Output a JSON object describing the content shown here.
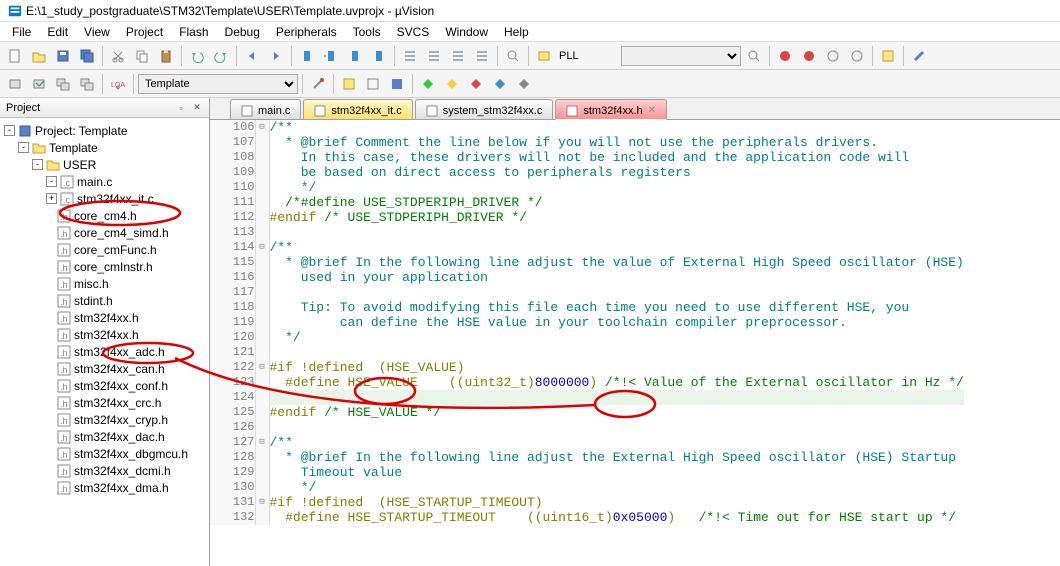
{
  "titlebar": "E:\\1_study_postgraduate\\STM32\\Template\\USER\\Template.uvprojx - µVision",
  "menu": [
    "File",
    "Edit",
    "View",
    "Project",
    "Flash",
    "Debug",
    "Peripherals",
    "Tools",
    "SVCS",
    "Window",
    "Help"
  ],
  "toolbar1": {
    "combo": ""
  },
  "toolbar2": {
    "target": "Template",
    "pll": "PLL"
  },
  "panel": {
    "title": "Project"
  },
  "tree": {
    "root": "Project: Template",
    "target": "Template",
    "group": "USER",
    "files": [
      "main.c",
      "stm32f4xx_it.c",
      "core_cm4.h",
      "core_cm4_simd.h",
      "core_cmFunc.h",
      "core_cmInstr.h",
      "misc.h",
      "stdint.h",
      "stm32f4xx.h",
      "stm32f4xx.h",
      "stm32f4xx_adc.h",
      "stm32f4xx_can.h",
      "stm32f4xx_conf.h",
      "stm32f4xx_crc.h",
      "stm32f4xx_cryp.h",
      "stm32f4xx_dac.h",
      "stm32f4xx_dbgmcu.h",
      "stm32f4xx_dcmi.h",
      "stm32f4xx_dma.h"
    ],
    "expanded": [
      true,
      false
    ]
  },
  "tabs": [
    {
      "label": "main.c",
      "state": "inactive"
    },
    {
      "label": "stm32f4xx_it.c",
      "state": "yellow"
    },
    {
      "label": "system_stm32f4xx.c",
      "state": "inactive"
    },
    {
      "label": "stm32f4xx.h",
      "state": "active"
    }
  ],
  "code_start": 106,
  "code_lines": [
    {
      "n": 106,
      "fold": "-",
      "cls": "",
      "html": "<span class='c-teal'>/**</span>"
    },
    {
      "n": 107,
      "fold": "",
      "cls": "",
      "html": "<span class='c-teal'>  * @brief Comment the line below if you will not use the peripherals drivers.</span>"
    },
    {
      "n": 108,
      "fold": "",
      "cls": "",
      "html": "<span class='c-teal'>    In this case, these drivers will not be included and the application code will</span>"
    },
    {
      "n": 109,
      "fold": "",
      "cls": "",
      "html": "<span class='c-teal'>    be based on direct access to peripherals registers</span>"
    },
    {
      "n": 110,
      "fold": "",
      "cls": "",
      "html": "<span class='c-teal'>    */</span>"
    },
    {
      "n": 111,
      "fold": "",
      "cls": "",
      "html": "  <span class='c-green'>/*#define USE_STDPERIPH_DRIVER */</span>"
    },
    {
      "n": 112,
      "fold": "",
      "cls": "",
      "html": "<span class='c-preproc'>#endif</span> <span class='c-green'>/* USE_STDPERIPH_DRIVER */</span>"
    },
    {
      "n": 113,
      "fold": "",
      "cls": "",
      "html": ""
    },
    {
      "n": 114,
      "fold": "-",
      "cls": "",
      "html": "<span class='c-teal'>/**</span>"
    },
    {
      "n": 115,
      "fold": "",
      "cls": "",
      "html": "<span class='c-teal'>  * @brief In the following line adjust the value of External High Speed oscillator (HSE)</span>"
    },
    {
      "n": 116,
      "fold": "",
      "cls": "",
      "html": "<span class='c-teal'>    used in your application</span>"
    },
    {
      "n": 117,
      "fold": "",
      "cls": "",
      "html": ""
    },
    {
      "n": 118,
      "fold": "",
      "cls": "",
      "html": "<span class='c-teal'>    Tip: To avoid modifying this file each time you need to use different HSE, you</span>"
    },
    {
      "n": 119,
      "fold": "",
      "cls": "",
      "html": "<span class='c-teal'>         can define the HSE value in your toolchain compiler preprocessor.</span>"
    },
    {
      "n": 120,
      "fold": "",
      "cls": "",
      "html": "<span class='c-teal'>  */</span>"
    },
    {
      "n": 121,
      "fold": "",
      "cls": "",
      "html": ""
    },
    {
      "n": 122,
      "fold": "-",
      "cls": "",
      "html": "<span class='c-preproc'>#if !defined  (HSE_VALUE)</span>"
    },
    {
      "n": 123,
      "fold": "",
      "cls": "",
      "html": "  <span class='c-preproc'>#define HSE_VALUE    ((uint32_t)</span><span class='c-num'>8000000</span><span class='c-preproc'>)</span> <span class='c-green'>/*!&lt; Value of the External oscillator in Hz */</span>"
    },
    {
      "n": 124,
      "fold": "",
      "cls": "hl-line",
      "html": "  "
    },
    {
      "n": 125,
      "fold": "",
      "cls": "",
      "html": "<span class='c-preproc'>#endif</span> <span class='c-green'>/* HSE_VALUE */</span>"
    },
    {
      "n": 126,
      "fold": "",
      "cls": "",
      "html": ""
    },
    {
      "n": 127,
      "fold": "-",
      "cls": "",
      "html": "<span class='c-teal'>/**</span>"
    },
    {
      "n": 128,
      "fold": "",
      "cls": "",
      "html": "<span class='c-teal'>  * @brief In the following line adjust the External High Speed oscillator (HSE) Startup</span>"
    },
    {
      "n": 129,
      "fold": "",
      "cls": "",
      "html": "<span class='c-teal'>    Timeout value</span>"
    },
    {
      "n": 130,
      "fold": "",
      "cls": "",
      "html": "<span class='c-teal'>    */</span>"
    },
    {
      "n": 131,
      "fold": "-",
      "cls": "",
      "html": "<span class='c-preproc'>#if !defined  (HSE_STARTUP_TIMEOUT)</span>"
    },
    {
      "n": 132,
      "fold": "",
      "cls": "",
      "html": "  <span class='c-preproc'>#define HSE_STARTUP_TIMEOUT    ((uint16_t)</span><span class='c-num'>0x05000</span><span class='c-preproc'>)</span>   <span class='c-green'>/*!&lt; Time out for HSE start up */</span>"
    }
  ],
  "watermark": ""
}
